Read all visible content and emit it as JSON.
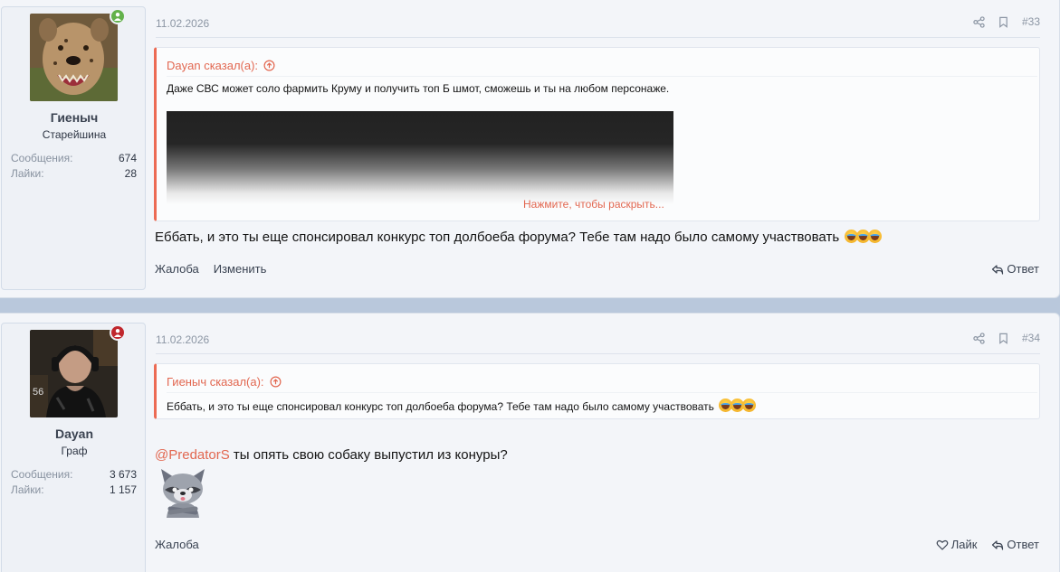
{
  "posts": [
    {
      "user": {
        "name": "Гиеныч",
        "title": "Старейшина",
        "status": "online",
        "stats": [
          {
            "label": "Сообщения:",
            "value": "674"
          },
          {
            "label": "Лайки:",
            "value": "28"
          }
        ]
      },
      "date": "11.02.2026",
      "post_number": "#33",
      "quote": {
        "author_line": "Dayan сказал(а):",
        "text": "Даже СВС может соло фармить Круму и получить топ Б шмот, сможешь и ты на любом персонаже.",
        "expand_label": "Нажмите, чтобы раскрыть..."
      },
      "message": "Еббать, и это ты еще спонсировал конкурс топ долбоеба форума? Тебе там надо было самому участвовать",
      "actions_left": [
        "Жалоба",
        "Изменить"
      ],
      "reply_label": "Ответ"
    },
    {
      "user": {
        "name": "Dayan",
        "title": "Граф",
        "status": "busy",
        "stats": [
          {
            "label": "Сообщения:",
            "value": "3 673"
          },
          {
            "label": "Лайки:",
            "value": "1 157"
          }
        ]
      },
      "date": "11.02.2026",
      "post_number": "#34",
      "quote": {
        "author_line": "Гиеныч сказал(а):",
        "text": "Еббать, и это ты еще спонсировал конкурс топ долбоеба форума? Тебе там надо было самому участвовать"
      },
      "mention": "@PredatorS",
      "message": " ты опять свою собаку выпустил из конуры?",
      "actions_left": [
        "Жалоба"
      ],
      "like_label": "Лайк",
      "reply_label": "Ответ"
    }
  ],
  "colors": {
    "accent": "#e26750",
    "page_bg": "#b9c8dc",
    "post_bg": "#f3f5f9",
    "online": "#63b14b",
    "busy": "#c0272d"
  }
}
